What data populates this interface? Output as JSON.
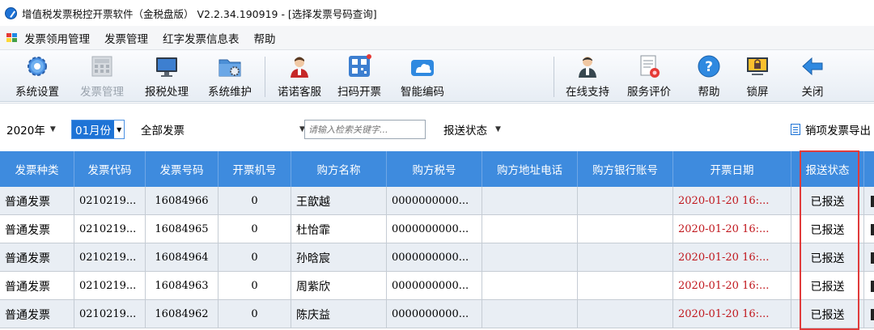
{
  "window": {
    "title": "增值税发票税控开票软件（金税盘版） V2.2.34.190919 - [选择发票号码查询]"
  },
  "menu": [
    "发票领用管理",
    "发票管理",
    "红字发票信息表",
    "帮助"
  ],
  "toolbar": [
    {
      "label": "系统设置",
      "icon": "gear-icon",
      "enabled": true
    },
    {
      "label": "发票管理",
      "icon": "calculator-icon",
      "enabled": false
    },
    {
      "label": "报税处理",
      "icon": "monitor-icon",
      "enabled": true
    },
    {
      "label": "系统维护",
      "icon": "folder-gear-icon",
      "enabled": true
    },
    {
      "label": "诺诺客服",
      "icon": "agent-icon",
      "enabled": true
    },
    {
      "label": "扫码开票",
      "icon": "qr-code-icon",
      "enabled": true
    },
    {
      "label": "智能编码",
      "icon": "cloud-icon",
      "enabled": true
    },
    {
      "label": "在线支持",
      "icon": "support-person-icon",
      "enabled": true
    },
    {
      "label": "服务评价",
      "icon": "rating-icon",
      "enabled": true
    },
    {
      "label": "帮助",
      "icon": "help-icon",
      "enabled": true
    },
    {
      "label": "锁屏",
      "icon": "lock-screen-icon",
      "enabled": true
    },
    {
      "label": "关闭",
      "icon": "back-arrow-icon",
      "enabled": true
    }
  ],
  "filters": {
    "year": "2020年",
    "month": "01月份",
    "invoice_type": "全部发票",
    "search_placeholder": "请输入检索关键字...",
    "report_status_label": "报送状态",
    "export_label": "销项发票导出"
  },
  "table": {
    "columns": [
      "发票种类",
      "发票代码",
      "发票号码",
      "开票机号",
      "购方名称",
      "购方税号",
      "购方地址电话",
      "购方银行账号",
      "开票日期",
      "报送状态"
    ],
    "rows": [
      [
        "普通发票",
        "0210219...",
        "16084966",
        "0",
        "王歆越",
        "0000000000...",
        "",
        "",
        "2020-01-20 16:...",
        "已报送"
      ],
      [
        "普通发票",
        "0210219...",
        "16084965",
        "0",
        "杜怡霏",
        "0000000000...",
        "",
        "",
        "2020-01-20 16:...",
        "已报送"
      ],
      [
        "普通发票",
        "0210219...",
        "16084964",
        "0",
        "孙晗宸",
        "0000000000...",
        "",
        "",
        "2020-01-20 16:...",
        "已报送"
      ],
      [
        "普通发票",
        "0210219...",
        "16084963",
        "0",
        "周紫欣",
        "0000000000...",
        "",
        "",
        "2020-01-20 16:...",
        "已报送"
      ],
      [
        "普通发票",
        "0210219...",
        "16084962",
        "0",
        "陈庆益",
        "0000000000...",
        "",
        "",
        "2020-01-20 16:...",
        "已报送"
      ]
    ]
  },
  "colors": {
    "header_bg": "#3e8bde",
    "date_text": "#c0161c",
    "highlight_border": "#e03b3b"
  }
}
